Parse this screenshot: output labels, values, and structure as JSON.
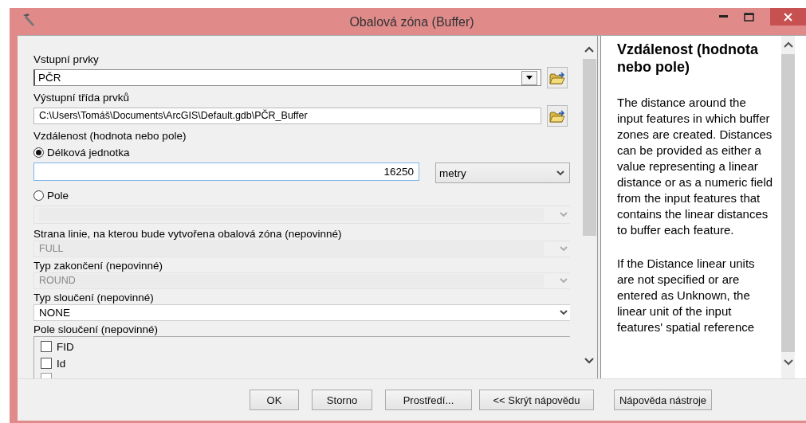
{
  "window": {
    "title": "Obalová zóna (Buffer)"
  },
  "params": [
    {
      "kind": "combo",
      "label": "Vstupní prvky",
      "value": "PČR"
    },
    {
      "kind": "text",
      "label": "Výstupní třída prvků",
      "value": "C:\\Users\\Tomáš\\Documents\\ArcGIS\\Default.gdb\\PČR_Buffer"
    },
    {
      "kind": "distance",
      "label": "Vzdálenost (hodnota nebo pole)",
      "options": [
        {
          "label": "Délková jednotka",
          "selected": true
        },
        {
          "label": "Pole",
          "selected": false
        }
      ],
      "value": "16250",
      "unit": "metry"
    },
    {
      "kind": "dropdown",
      "label": "Strana linie, na kterou bude vytvořena obalová zóna (nepovinné)",
      "value": "FULL",
      "disabled": true
    },
    {
      "kind": "dropdown",
      "label": "Typ zakončení (nepovinné)",
      "value": "ROUND",
      "disabled": true
    },
    {
      "kind": "dropdown",
      "label": "Typ sloučení (nepovinné)",
      "value": "NONE",
      "disabled": false
    },
    {
      "kind": "checklist",
      "label": "Pole sloučení (nepovinné)",
      "items": [
        {
          "label": "FID",
          "checked": false
        },
        {
          "label": "Id",
          "checked": false
        }
      ]
    }
  ],
  "help": {
    "title": "Vzdálenost (hodnota nebo pole)",
    "paragraphs": [
      "The distance around the input features in which buffer zones are created. Distances can be provided as either a value representing a linear distance or as a numeric field from the input features that contains the linear distances to buffer each feature.",
      "If the Distance linear units are not specified or are entered as Unknown, the linear unit of the input features' spatial reference"
    ]
  },
  "buttons": [
    "OK",
    "Storno",
    "Prostředí...",
    "<< Skrýt nápovědu",
    "Nápověda nástroje"
  ]
}
